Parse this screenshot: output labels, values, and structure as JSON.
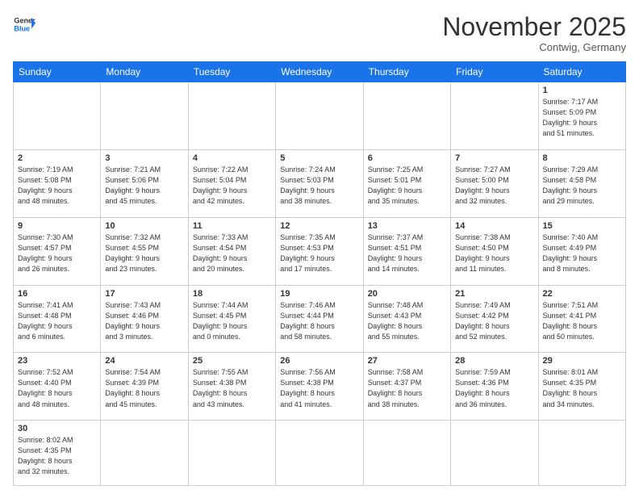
{
  "header": {
    "logo_general": "General",
    "logo_blue": "Blue",
    "month_title": "November 2025",
    "location": "Contwig, Germany"
  },
  "weekdays": [
    "Sunday",
    "Monday",
    "Tuesday",
    "Wednesday",
    "Thursday",
    "Friday",
    "Saturday"
  ],
  "weeks": [
    [
      {
        "day": "",
        "info": ""
      },
      {
        "day": "",
        "info": ""
      },
      {
        "day": "",
        "info": ""
      },
      {
        "day": "",
        "info": ""
      },
      {
        "day": "",
        "info": ""
      },
      {
        "day": "",
        "info": ""
      },
      {
        "day": "1",
        "info": "Sunrise: 7:17 AM\nSunset: 5:09 PM\nDaylight: 9 hours\nand 51 minutes."
      }
    ],
    [
      {
        "day": "2",
        "info": "Sunrise: 7:19 AM\nSunset: 5:08 PM\nDaylight: 9 hours\nand 48 minutes."
      },
      {
        "day": "3",
        "info": "Sunrise: 7:21 AM\nSunset: 5:06 PM\nDaylight: 9 hours\nand 45 minutes."
      },
      {
        "day": "4",
        "info": "Sunrise: 7:22 AM\nSunset: 5:04 PM\nDaylight: 9 hours\nand 42 minutes."
      },
      {
        "day": "5",
        "info": "Sunrise: 7:24 AM\nSunset: 5:03 PM\nDaylight: 9 hours\nand 38 minutes."
      },
      {
        "day": "6",
        "info": "Sunrise: 7:25 AM\nSunset: 5:01 PM\nDaylight: 9 hours\nand 35 minutes."
      },
      {
        "day": "7",
        "info": "Sunrise: 7:27 AM\nSunset: 5:00 PM\nDaylight: 9 hours\nand 32 minutes."
      },
      {
        "day": "8",
        "info": "Sunrise: 7:29 AM\nSunset: 4:58 PM\nDaylight: 9 hours\nand 29 minutes."
      }
    ],
    [
      {
        "day": "9",
        "info": "Sunrise: 7:30 AM\nSunset: 4:57 PM\nDaylight: 9 hours\nand 26 minutes."
      },
      {
        "day": "10",
        "info": "Sunrise: 7:32 AM\nSunset: 4:55 PM\nDaylight: 9 hours\nand 23 minutes."
      },
      {
        "day": "11",
        "info": "Sunrise: 7:33 AM\nSunset: 4:54 PM\nDaylight: 9 hours\nand 20 minutes."
      },
      {
        "day": "12",
        "info": "Sunrise: 7:35 AM\nSunset: 4:53 PM\nDaylight: 9 hours\nand 17 minutes."
      },
      {
        "day": "13",
        "info": "Sunrise: 7:37 AM\nSunset: 4:51 PM\nDaylight: 9 hours\nand 14 minutes."
      },
      {
        "day": "14",
        "info": "Sunrise: 7:38 AM\nSunset: 4:50 PM\nDaylight: 9 hours\nand 11 minutes."
      },
      {
        "day": "15",
        "info": "Sunrise: 7:40 AM\nSunset: 4:49 PM\nDaylight: 9 hours\nand 8 minutes."
      }
    ],
    [
      {
        "day": "16",
        "info": "Sunrise: 7:41 AM\nSunset: 4:48 PM\nDaylight: 9 hours\nand 6 minutes."
      },
      {
        "day": "17",
        "info": "Sunrise: 7:43 AM\nSunset: 4:46 PM\nDaylight: 9 hours\nand 3 minutes."
      },
      {
        "day": "18",
        "info": "Sunrise: 7:44 AM\nSunset: 4:45 PM\nDaylight: 9 hours\nand 0 minutes."
      },
      {
        "day": "19",
        "info": "Sunrise: 7:46 AM\nSunset: 4:44 PM\nDaylight: 8 hours\nand 58 minutes."
      },
      {
        "day": "20",
        "info": "Sunrise: 7:48 AM\nSunset: 4:43 PM\nDaylight: 8 hours\nand 55 minutes."
      },
      {
        "day": "21",
        "info": "Sunrise: 7:49 AM\nSunset: 4:42 PM\nDaylight: 8 hours\nand 52 minutes."
      },
      {
        "day": "22",
        "info": "Sunrise: 7:51 AM\nSunset: 4:41 PM\nDaylight: 8 hours\nand 50 minutes."
      }
    ],
    [
      {
        "day": "23",
        "info": "Sunrise: 7:52 AM\nSunset: 4:40 PM\nDaylight: 8 hours\nand 48 minutes."
      },
      {
        "day": "24",
        "info": "Sunrise: 7:54 AM\nSunset: 4:39 PM\nDaylight: 8 hours\nand 45 minutes."
      },
      {
        "day": "25",
        "info": "Sunrise: 7:55 AM\nSunset: 4:38 PM\nDaylight: 8 hours\nand 43 minutes."
      },
      {
        "day": "26",
        "info": "Sunrise: 7:56 AM\nSunset: 4:38 PM\nDaylight: 8 hours\nand 41 minutes."
      },
      {
        "day": "27",
        "info": "Sunrise: 7:58 AM\nSunset: 4:37 PM\nDaylight: 8 hours\nand 38 minutes."
      },
      {
        "day": "28",
        "info": "Sunrise: 7:59 AM\nSunset: 4:36 PM\nDaylight: 8 hours\nand 36 minutes."
      },
      {
        "day": "29",
        "info": "Sunrise: 8:01 AM\nSunset: 4:35 PM\nDaylight: 8 hours\nand 34 minutes."
      }
    ],
    [
      {
        "day": "30",
        "info": "Sunrise: 8:02 AM\nSunset: 4:35 PM\nDaylight: 8 hours\nand 32 minutes."
      },
      {
        "day": "",
        "info": ""
      },
      {
        "day": "",
        "info": ""
      },
      {
        "day": "",
        "info": ""
      },
      {
        "day": "",
        "info": ""
      },
      {
        "day": "",
        "info": ""
      },
      {
        "day": "",
        "info": ""
      }
    ]
  ]
}
